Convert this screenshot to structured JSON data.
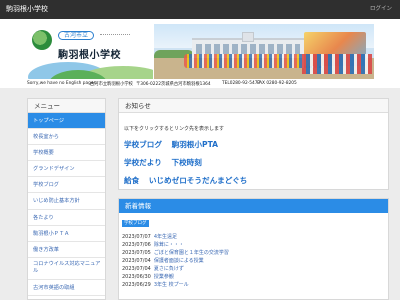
{
  "topbar": {
    "site_title": "駒羽根小学校",
    "login_label": "ログイン"
  },
  "header": {
    "city_label": "古河市立",
    "school_name": "駒羽根小学校"
  },
  "infobar": {
    "english": "Sorry,we have no English pages.",
    "school_full": "古河市立駒羽根小学校",
    "address": "〒306-0222茨城県古河市駒羽根1364",
    "tel": "TEL0280-92-5477",
    "fax": "FAX 0280-92-8205"
  },
  "sidebar": {
    "heading": "メニュー",
    "items": [
      {
        "label": "トップページ",
        "active": true
      },
      {
        "label": "校長室から"
      },
      {
        "label": "学校概要"
      },
      {
        "label": "グランドデザイン"
      },
      {
        "label": "学校ブログ"
      },
      {
        "label": "いじめ防止基本方針"
      },
      {
        "label": "各たより"
      },
      {
        "label": "駒羽根小ＰＴＡ"
      },
      {
        "label": "働き方改革"
      },
      {
        "label": "コロナウイルス対応マニュアル"
      },
      {
        "label": "古河市英語の取組"
      }
    ]
  },
  "notice": {
    "heading": "お知らせ",
    "intro": "以下をクリックするとリンク先を表示します",
    "row1": [
      "学校ブログ",
      "駒羽根小PTA"
    ],
    "row2": [
      "学校だより",
      "下校時刻"
    ],
    "row3": [
      "給食",
      "いじめゼロそうだんまどぐち"
    ]
  },
  "news": {
    "heading": "新着情報",
    "badge": "学校ブログ",
    "items": [
      {
        "date": "2023/07/07",
        "title": "4年生遠足"
      },
      {
        "date": "2023/07/06",
        "title": "除茸に・・・"
      },
      {
        "date": "2023/07/05",
        "title": "ごぼと保育園と１年生の交流学習"
      },
      {
        "date": "2023/07/04",
        "title": "保護者面談による授業"
      },
      {
        "date": "2023/07/04",
        "title": "夏さに負けず"
      },
      {
        "date": "2023/06/30",
        "title": "授業参観"
      },
      {
        "date": "2023/06/29",
        "title": "3年生 校プール"
      }
    ]
  },
  "colors": {
    "accent": "#2b8ce6",
    "link": "#1e6ec9",
    "topbar": "#2f2f2f"
  }
}
